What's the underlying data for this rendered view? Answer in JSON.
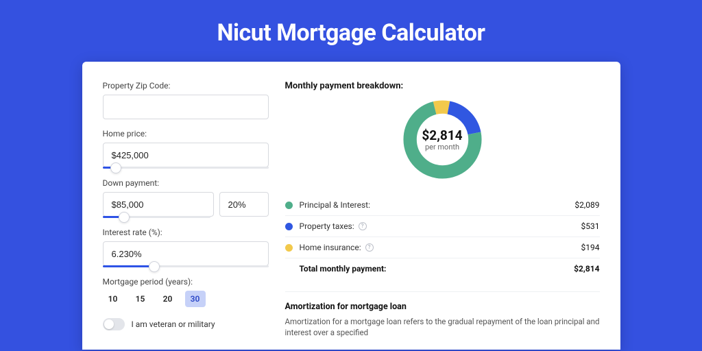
{
  "title": "Nicut Mortgage Calculator",
  "form": {
    "zip": {
      "label": "Property Zip Code:",
      "value": ""
    },
    "homePrice": {
      "label": "Home price:",
      "value": "$425,000",
      "sliderPct": 8
    },
    "downPayment": {
      "label": "Down payment:",
      "value": "$85,000",
      "pct": "20%",
      "sliderPct": 20
    },
    "interestRate": {
      "label": "Interest rate (%):",
      "value": "6.230%",
      "sliderPct": 31
    },
    "mortgagePeriod": {
      "label": "Mortgage period (years):",
      "options": [
        "10",
        "15",
        "20",
        "30"
      ],
      "active": "30"
    },
    "veteran": {
      "label": "I am veteran or military",
      "on": false
    }
  },
  "breakdown": {
    "title": "Monthly payment breakdown:",
    "center": {
      "amount": "$2,814",
      "sub": "per month"
    },
    "rows": [
      {
        "label": "Principal & Interest:",
        "value": "$2,089",
        "color": "#4fae8a",
        "info": false
      },
      {
        "label": "Property taxes:",
        "value": "$531",
        "color": "#3057e1",
        "info": true
      },
      {
        "label": "Home insurance:",
        "value": "$194",
        "color": "#f2c94c",
        "info": true
      }
    ],
    "total": {
      "label": "Total monthly payment:",
      "value": "$2,814"
    }
  },
  "chart_data": {
    "type": "pie",
    "title": "Monthly payment breakdown",
    "series": [
      {
        "name": "Principal & Interest",
        "value": 2089,
        "color": "#4fae8a"
      },
      {
        "name": "Property taxes",
        "value": 531,
        "color": "#3057e1"
      },
      {
        "name": "Home insurance",
        "value": 194,
        "color": "#f2c94c"
      }
    ],
    "total": 2814,
    "center_label": "$2,814 per month"
  },
  "amort": {
    "title": "Amortization for mortgage loan",
    "text": "Amortization for a mortgage loan refers to the gradual repayment of the loan principal and interest over a specified"
  }
}
